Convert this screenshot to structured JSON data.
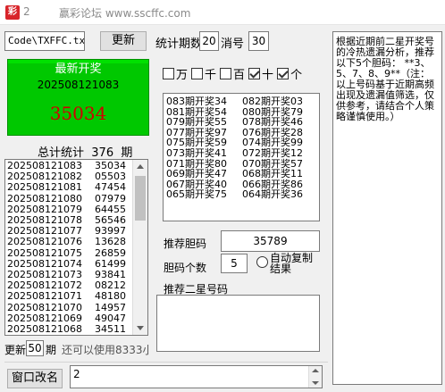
{
  "titlebar": {
    "number": "2",
    "title": "赢彩论坛 www.sscffc.com"
  },
  "top": {
    "file_value": "Code\\TXFFC.txt",
    "refresh_label": "更新",
    "stat_periods_label": "统计期数",
    "stat_periods_value": "20",
    "miss_label": "消号",
    "miss_value": "30"
  },
  "latest": {
    "heading": "最新开奖",
    "issue": "202508121083",
    "number": "35034"
  },
  "stats": {
    "label": "总计统计",
    "count": "376",
    "unit": "期",
    "rows": [
      [
        "202508121083",
        "35034"
      ],
      [
        "202508121082",
        "05503"
      ],
      [
        "202508121081",
        "47454"
      ],
      [
        "202508121080",
        "07979"
      ],
      [
        "202508121079",
        "64455"
      ],
      [
        "202508121078",
        "56546"
      ],
      [
        "202508121077",
        "93997"
      ],
      [
        "202508121076",
        "13628"
      ],
      [
        "202508121075",
        "26859"
      ],
      [
        "202508121074",
        "61499"
      ],
      [
        "202508121073",
        "93841"
      ],
      [
        "202508121072",
        "08212"
      ],
      [
        "202508121071",
        "48180"
      ],
      [
        "202508121070",
        "14957"
      ],
      [
        "202508121069",
        "49047"
      ],
      [
        "202508121068",
        "34511"
      ]
    ]
  },
  "update": {
    "prefix": "更新",
    "value": "50",
    "suffix": "期",
    "remaining_text": "还可以使用8333小"
  },
  "positions": [
    {
      "label": "万",
      "checked": false
    },
    {
      "label": "千",
      "checked": false
    },
    {
      "label": "百",
      "checked": false
    },
    {
      "label": "十",
      "checked": true
    },
    {
      "label": "个",
      "checked": true
    }
  ],
  "history": [
    [
      "083期开奖34",
      "082期开奖03"
    ],
    [
      "081期开奖54",
      "080期开奖79"
    ],
    [
      "079期开奖55",
      "078期开奖46"
    ],
    [
      "077期开奖97",
      "076期开奖28"
    ],
    [
      "075期开奖59",
      "074期开奖99"
    ],
    [
      "073期开奖41",
      "072期开奖12"
    ],
    [
      "071期开奖80",
      "070期开奖57"
    ],
    [
      "069期开奖47",
      "068期开奖11"
    ],
    [
      "067期开奖40",
      "066期开奖86"
    ],
    [
      "065期开奖75",
      "064期开奖36"
    ]
  ],
  "recommend": {
    "bile_label": "推荐胆码",
    "bile_value": "35789",
    "count_label": "胆码个数",
    "count_value": "5",
    "auto_copy_label": "自动复制结果",
    "two_star_label": "推荐二星号码",
    "two_star_value": ""
  },
  "advice": "根据近期前二星开奖号的冷热遗漏分析，推荐以下5个胆码：  **3、5、7、8、9**（注：以上号码基于近期高频出现及遗漏值筛选，仅供参考，请结合个人策略谨慎使用。）",
  "bottom": {
    "rename_label": "窗口改名",
    "name_value": "2"
  }
}
